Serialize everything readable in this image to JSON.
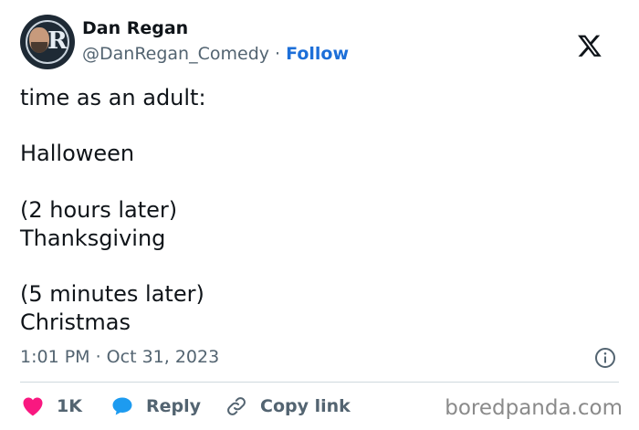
{
  "author": {
    "name": "Dan Regan",
    "handle": "@DanRegan_Comedy",
    "separator": "·",
    "follow_label": "Follow"
  },
  "tweet": {
    "text": "time as an adult:\n\nHalloween\n\n(2 hours later)\nThanksgiving\n\n(5 minutes later)\nChristmas",
    "timestamp": "1:01 PM · Oct 31, 2023"
  },
  "actions": {
    "like_count": "1K",
    "reply_label": "Reply",
    "copy_label": "Copy link"
  },
  "watermark": "boredpanda.com",
  "icons": [
    "x-logo-icon",
    "info-icon",
    "heart-icon",
    "reply-bubble-icon",
    "link-icon"
  ],
  "colors": {
    "text": "#0f1419",
    "muted": "#536471",
    "follow": "#1d6fd8",
    "heart": "#f91880",
    "reply": "#1d9bf0",
    "divider": "#cfd9de"
  }
}
